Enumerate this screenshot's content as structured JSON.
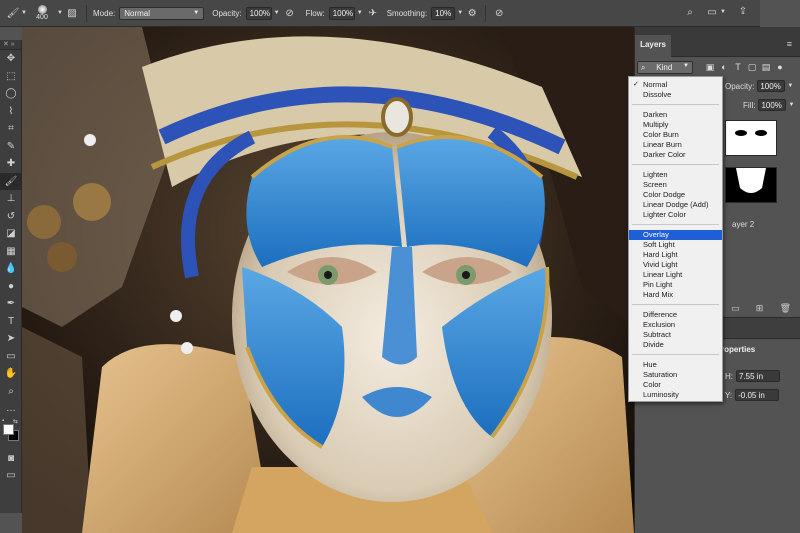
{
  "options_bar": {
    "brush_size": "400",
    "mode_label": "Mode:",
    "mode_value": "Normal",
    "opacity_label": "Opacity:",
    "opacity_value": "100%",
    "flow_label": "Flow:",
    "flow_value": "100%",
    "smoothing_label": "Smoothing:",
    "smoothing_value": "10%"
  },
  "layers_panel": {
    "tab_label": "Layers",
    "kind_label": "Kind",
    "opacity_label": "Opacity:",
    "opacity_value": "100%",
    "fill_label": "Fill:",
    "fill_value": "100%",
    "layer2_name": "ayer 2"
  },
  "properties_panel": {
    "title": "roperties",
    "h_label": "H:",
    "h_value": "7.55 in",
    "y_label": "Y:",
    "y_value": "-0.05 in"
  },
  "blend_menu": {
    "groups": [
      [
        "Normal",
        "Dissolve"
      ],
      [
        "Darken",
        "Multiply",
        "Color Burn",
        "Linear Burn",
        "Darker Color"
      ],
      [
        "Lighten",
        "Screen",
        "Color Dodge",
        "Linear Dodge (Add)",
        "Lighter Color"
      ],
      [
        "Overlay",
        "Soft Light",
        "Hard Light",
        "Vivid Light",
        "Linear Light",
        "Pin Light",
        "Hard Mix"
      ],
      [
        "Difference",
        "Exclusion",
        "Subtract",
        "Divide"
      ],
      [
        "Hue",
        "Saturation",
        "Color",
        "Luminosity"
      ]
    ],
    "checked": "Normal",
    "highlighted": "Overlay"
  },
  "colors": {
    "foreground": "#ffffff",
    "background": "#000000",
    "menu_highlight": "#1e5ed6"
  },
  "icons": {
    "toolbar": [
      "move-icon",
      "marquee-icon",
      "lasso-icon",
      "quick-select-icon",
      "crop-icon",
      "eyedropper-icon",
      "healing-icon",
      "brush-icon",
      "stamp-icon",
      "history-brush-icon",
      "eraser-icon",
      "gradient-icon",
      "blur-icon",
      "dodge-icon",
      "pen-icon",
      "type-icon",
      "path-select-icon",
      "rectangle-icon",
      "hand-icon",
      "zoom-icon",
      "more-tools-icon"
    ]
  }
}
